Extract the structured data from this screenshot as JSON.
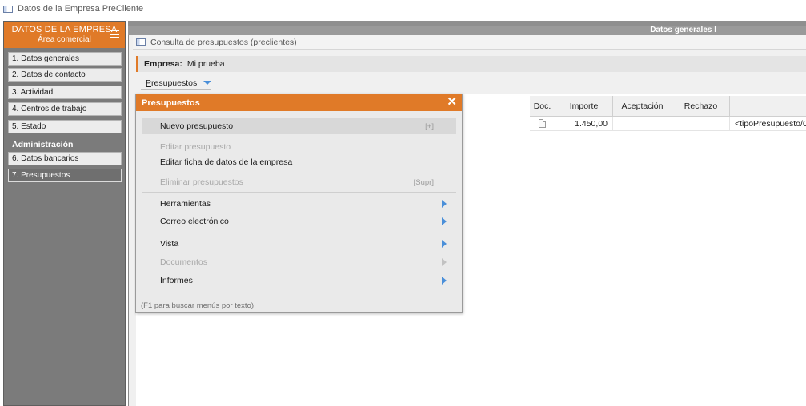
{
  "window": {
    "title": "Datos de la Empresa PreCliente"
  },
  "sidebar": {
    "header_title": "DATOS DE LA EMPRESA",
    "header_subtitle": "Área comercial",
    "items": [
      {
        "label": "1. Datos generales"
      },
      {
        "label": "2. Datos de contacto"
      },
      {
        "label": "3. Actividad"
      },
      {
        "label": "4. Centros de trabajo"
      },
      {
        "label": "5. Estado"
      }
    ],
    "section_admin": "Administración",
    "admin_items": [
      {
        "label": "6. Datos bancarios"
      },
      {
        "label": "7. Presupuestos",
        "selected": true
      }
    ]
  },
  "main": {
    "header": "Datos generales I",
    "inner_title": "Consulta de presupuestos (preclientes)",
    "empresa_label": "Empresa:",
    "empresa_value": "Mi prueba",
    "presupuestos_button_first": "P",
    "presupuestos_button_rest": "resupuestos"
  },
  "table": {
    "columns": [
      "Doc.",
      "Importe",
      "Aceptación",
      "Rechazo",
      ""
    ],
    "rows": [
      {
        "importe": "1.450,00",
        "aceptacion": "",
        "rechazo": "",
        "extra": "<tipoPresupuesto/Contra"
      }
    ]
  },
  "popup": {
    "title": "Presupuestos",
    "items": {
      "nuevo": {
        "label": "Nuevo presupuesto",
        "shortcut": "[+]"
      },
      "editar": {
        "label": "Editar presupuesto"
      },
      "editar_ficha": {
        "label": "Editar ficha de datos de la empresa"
      },
      "eliminar": {
        "label": "Eliminar presupuestos",
        "shortcut": "[Supr]"
      },
      "herramientas": {
        "label": "Herramientas"
      },
      "correo": {
        "label": "Correo electrónico"
      },
      "vista": {
        "label": "Vista"
      },
      "documentos": {
        "label": "Documentos"
      },
      "informes": {
        "label": "Informes"
      }
    },
    "footer": "(F1 para buscar menús por texto)"
  },
  "colors": {
    "accent": "#e07a28",
    "arrow": "#4a8fd9",
    "sidebar_bg": "#7b7b7b"
  }
}
